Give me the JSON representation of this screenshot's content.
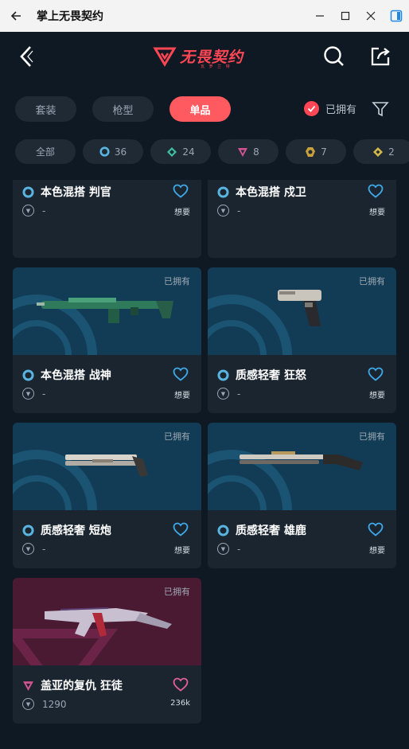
{
  "window": {
    "title": "掌上无畏契约"
  },
  "header": {
    "logo_text": "无畏契约",
    "logo_sub": "瓦 罗 兰 特"
  },
  "tabs": [
    {
      "label": "套装"
    },
    {
      "label": "枪型"
    },
    {
      "label": "单品"
    }
  ],
  "owned_filter": {
    "label": "已拥有",
    "checked": true
  },
  "chips": [
    {
      "label": "全部"
    },
    {
      "label": "36",
      "icon": "select-tier-icon",
      "color": "#5ab4e0"
    },
    {
      "label": "24",
      "icon": "deluxe-tier-icon",
      "color": "#3fbfa0"
    },
    {
      "label": "8",
      "icon": "premium-tier-icon",
      "color": "#d1548e"
    },
    {
      "label": "7",
      "icon": "exclusive-tier-icon",
      "color": "#f5955b"
    },
    {
      "label": "2",
      "icon": "ultra-tier-icon",
      "color": "#fad663"
    }
  ],
  "cards": [
    {
      "name": "本色混搭 判官",
      "price": "-",
      "want": "想要",
      "owned": "",
      "tier": "select"
    },
    {
      "name": "本色混搭 戍卫",
      "price": "-",
      "want": "想要",
      "owned": "",
      "tier": "select"
    },
    {
      "name": "本色混搭 战神",
      "price": "-",
      "want": "想要",
      "owned": "已拥有",
      "tier": "select",
      "weapon": "rifle-green"
    },
    {
      "name": "质感轻奢 狂怒",
      "price": "-",
      "want": "想要",
      "owned": "已拥有",
      "tier": "select",
      "weapon": "pistol"
    },
    {
      "name": "质感轻奢 短炮",
      "price": "-",
      "want": "想要",
      "owned": "已拥有",
      "tier": "select",
      "weapon": "shorty"
    },
    {
      "name": "质感轻奢 雄鹿",
      "price": "-",
      "want": "想要",
      "owned": "已拥有",
      "tier": "select",
      "weapon": "shotgun"
    },
    {
      "name": "盖亚的复仇 狂徒",
      "price": "1290",
      "want": "236k",
      "owned": "已拥有",
      "tier": "premium",
      "weapon": "vandal"
    }
  ],
  "colors": {
    "accent": "#ff4655",
    "select_tier": "#5ab4e0",
    "premium_tier": "#d1548e",
    "heart_blue": "#3fa9e8",
    "heart_pink": "#e0609a"
  }
}
